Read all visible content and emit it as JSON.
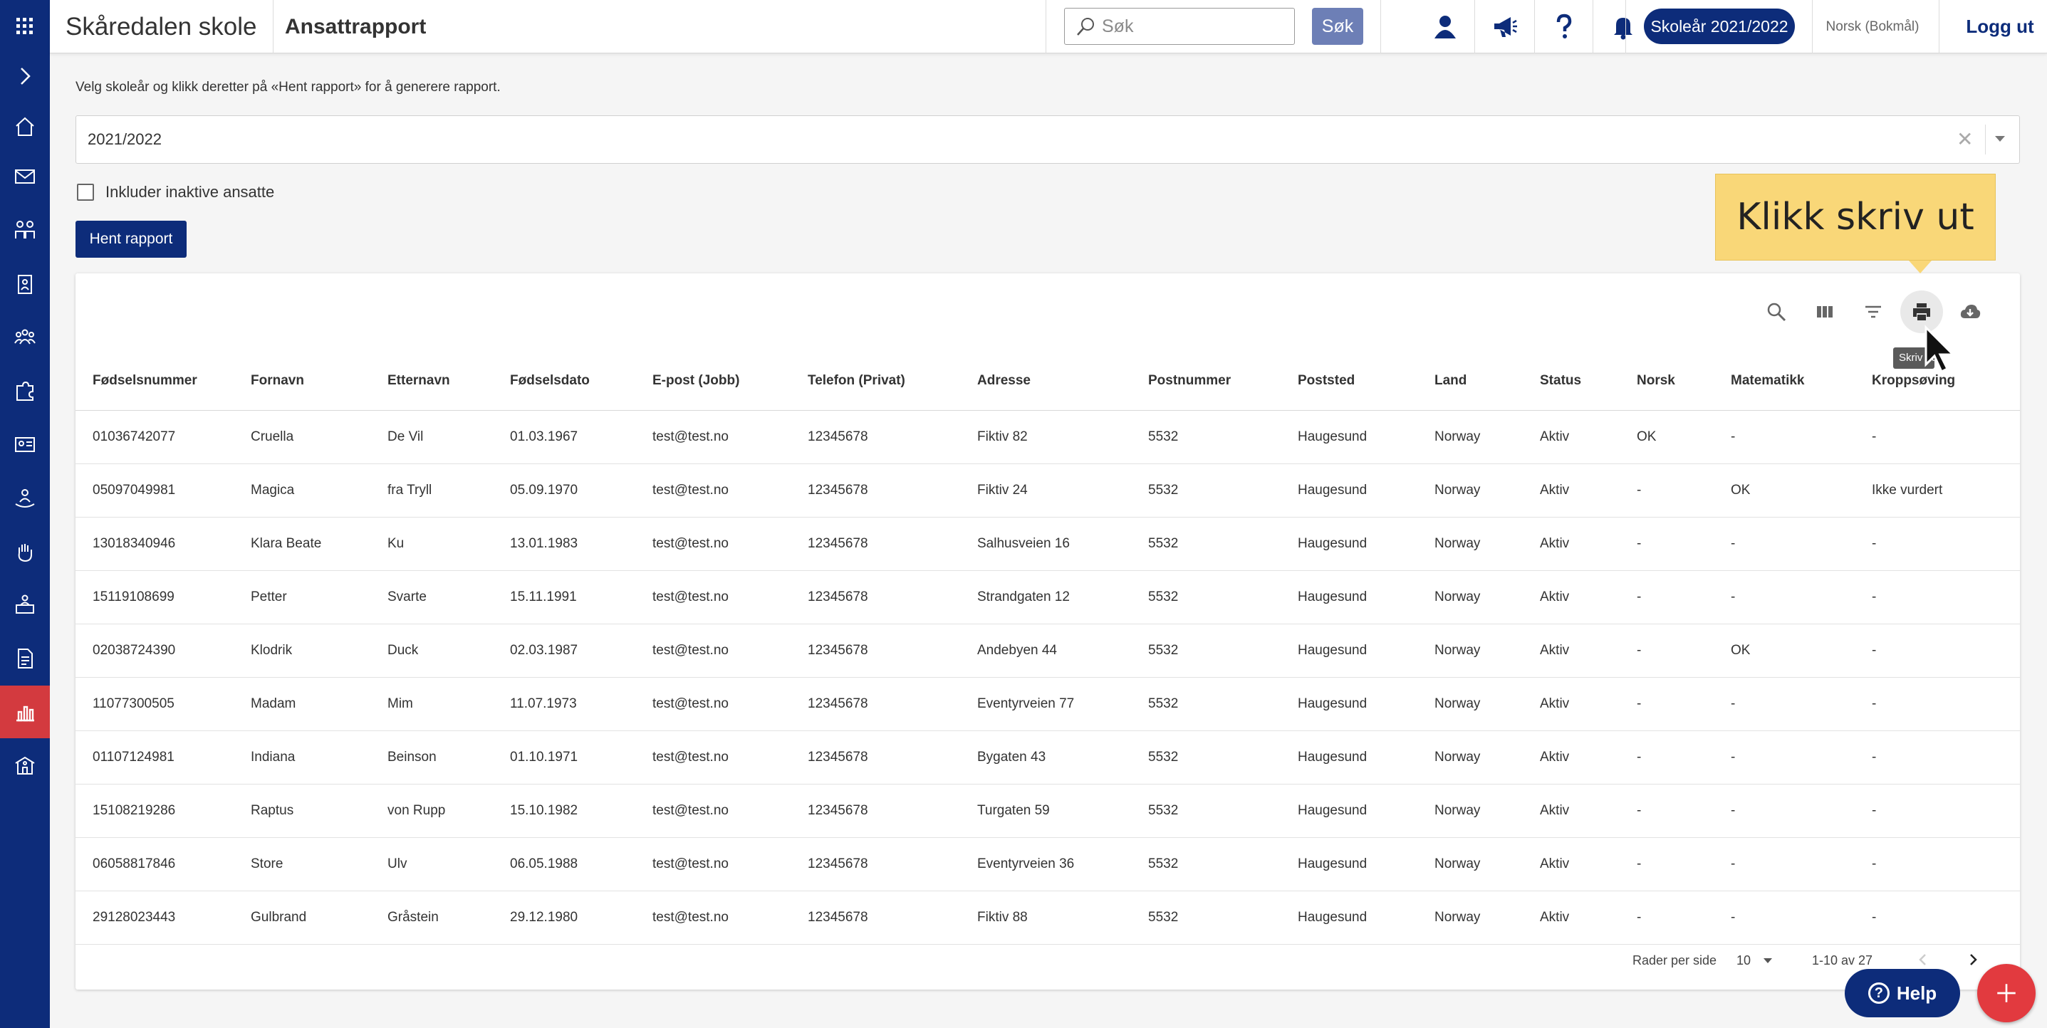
{
  "header": {
    "school_name": "Skåredalen skole",
    "page_title": "Ansattrapport",
    "search_placeholder": "Søk",
    "search_button": "Søk",
    "schoolyear_button": "Skoleår 2021/2022",
    "language": "Norsk (Bokmål)",
    "logout": "Logg ut",
    "icons": [
      "profile-icon",
      "megaphone-icon",
      "help-question-icon",
      "bell-icon"
    ]
  },
  "sidebar": {
    "items": [
      "apps-grid-icon",
      "expand-chevron-icon",
      "home-icon",
      "mail-icon",
      "groups-icon",
      "badge-icon",
      "team-icon",
      "puzzle-icon",
      "id-card-icon",
      "person-care-icon",
      "hand-icon",
      "desk-icon",
      "document-icon",
      "bar-chart-icon",
      "school-icon"
    ],
    "active": "bar-chart-icon",
    "colors": {
      "background": "#0d2c7a",
      "active": "#d33a3f"
    }
  },
  "filters": {
    "instruction": "Velg skoleår og klikk deretter på «Hent rapport» for å generere rapport.",
    "year_value": "2021/2022",
    "include_inactive_label": "Inkluder inaktive ansatte",
    "include_inactive_checked": false,
    "fetch_button": "Hent rapport"
  },
  "callout": {
    "text": "Klikk skriv ut"
  },
  "tooltip": {
    "text": "Skriv ut"
  },
  "toolbar": {
    "icons": [
      "search-icon",
      "columns-icon",
      "filter-icon",
      "print-icon",
      "cloud-download-icon"
    ]
  },
  "table": {
    "headers": [
      "Fødselsnummer",
      "Fornavn",
      "Etternavn",
      "Fødselsdato",
      "E-post (Jobb)",
      "Telefon (Privat)",
      "Adresse",
      "Postnummer",
      "Poststed",
      "Land",
      "Status",
      "Norsk",
      "Matematikk",
      "Kroppsøving"
    ],
    "rows": [
      [
        "01036742077",
        "Cruella",
        "De Vil",
        "01.03.1967",
        "test@test.no",
        "12345678",
        "Fiktiv 82",
        "5532",
        "Haugesund",
        "Norway",
        "Aktiv",
        "OK",
        "-",
        "-"
      ],
      [
        "05097049981",
        "Magica",
        "fra Tryll",
        "05.09.1970",
        "test@test.no",
        "12345678",
        "Fiktiv 24",
        "5532",
        "Haugesund",
        "Norway",
        "Aktiv",
        "-",
        "OK",
        "Ikke vurdert"
      ],
      [
        "13018340946",
        "Klara Beate",
        "Ku",
        "13.01.1983",
        "test@test.no",
        "12345678",
        "Salhusveien 16",
        "5532",
        "Haugesund",
        "Norway",
        "Aktiv",
        "-",
        "-",
        "-"
      ],
      [
        "15119108699",
        "Petter",
        "Svarte",
        "15.11.1991",
        "test@test.no",
        "12345678",
        "Strandgaten 12",
        "5532",
        "Haugesund",
        "Norway",
        "Aktiv",
        "-",
        "-",
        "-"
      ],
      [
        "02038724390",
        "Klodrik",
        "Duck",
        "02.03.1987",
        "test@test.no",
        "12345678",
        "Andebyen 44",
        "5532",
        "Haugesund",
        "Norway",
        "Aktiv",
        "-",
        "OK",
        "-"
      ],
      [
        "11077300505",
        "Madam",
        "Mim",
        "11.07.1973",
        "test@test.no",
        "12345678",
        "Eventyrveien 77",
        "5532",
        "Haugesund",
        "Norway",
        "Aktiv",
        "-",
        "-",
        "-"
      ],
      [
        "01107124981",
        "Indiana",
        "Beinson",
        "01.10.1971",
        "test@test.no",
        "12345678",
        "Bygaten 43",
        "5532",
        "Haugesund",
        "Norway",
        "Aktiv",
        "-",
        "-",
        "-"
      ],
      [
        "15108219286",
        "Raptus",
        "von Rupp",
        "15.10.1982",
        "test@test.no",
        "12345678",
        "Turgaten 59",
        "5532",
        "Haugesund",
        "Norway",
        "Aktiv",
        "-",
        "-",
        "-"
      ],
      [
        "06058817846",
        "Store",
        "Ulv",
        "06.05.1988",
        "test@test.no",
        "12345678",
        "Eventyrveien 36",
        "5532",
        "Haugesund",
        "Norway",
        "Aktiv",
        "-",
        "-",
        "-"
      ],
      [
        "29128023443",
        "Gulbrand",
        "Gråstein",
        "29.12.1980",
        "test@test.no",
        "12345678",
        "Fiktiv 88",
        "5532",
        "Haugesund",
        "Norway",
        "Aktiv",
        "-",
        "-",
        "-"
      ]
    ]
  },
  "pagination": {
    "rows_per_page_label": "Rader per side",
    "rows_per_page": "10",
    "range": "1-10 av 27"
  },
  "floating": {
    "help_label": "Help",
    "help_glyph": "?"
  },
  "colors": {
    "brand": "#0d2c7a",
    "accent_red": "#e23a3f",
    "callout": "#f9d778",
    "search_button": "#6d7fb6"
  }
}
